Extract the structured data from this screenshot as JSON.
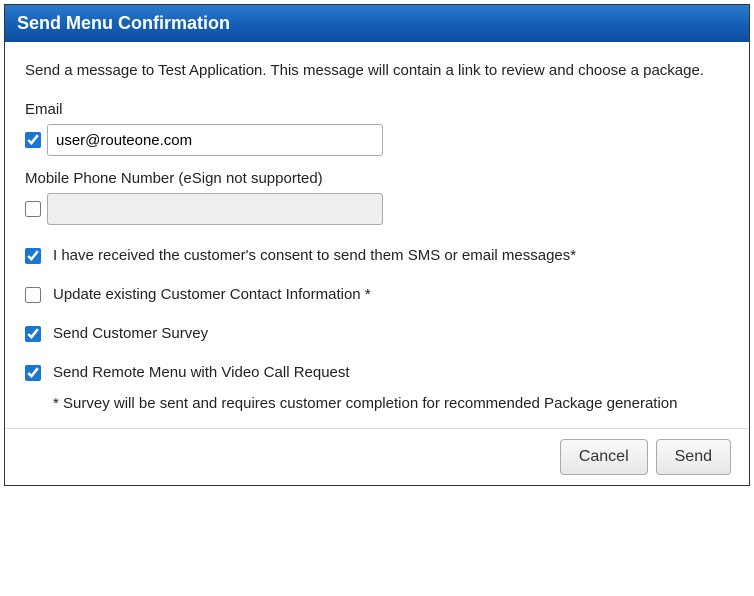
{
  "header": {
    "title": "Send Menu Confirmation"
  },
  "body": {
    "intro": "Send a message to Test Application. This message will contain a link to review and choose a package.",
    "email": {
      "label": "Email",
      "value": "user@routeone.com",
      "checked": true
    },
    "phone": {
      "label": "Mobile Phone Number (eSign not supported)",
      "value": "",
      "checked": false
    },
    "consent": {
      "label": "I have received the customer's consent to send them SMS or email messages*",
      "checked": true
    },
    "update_contact": {
      "label": "Update existing Customer Contact Information *",
      "checked": false
    },
    "survey": {
      "label": "Send Customer Survey",
      "checked": true
    },
    "video_call": {
      "label": "Send Remote Menu with Video Call Request",
      "checked": true
    },
    "note": "* Survey will be sent and requires customer completion for recommended Package generation"
  },
  "footer": {
    "cancel_label": "Cancel",
    "send_label": "Send"
  }
}
